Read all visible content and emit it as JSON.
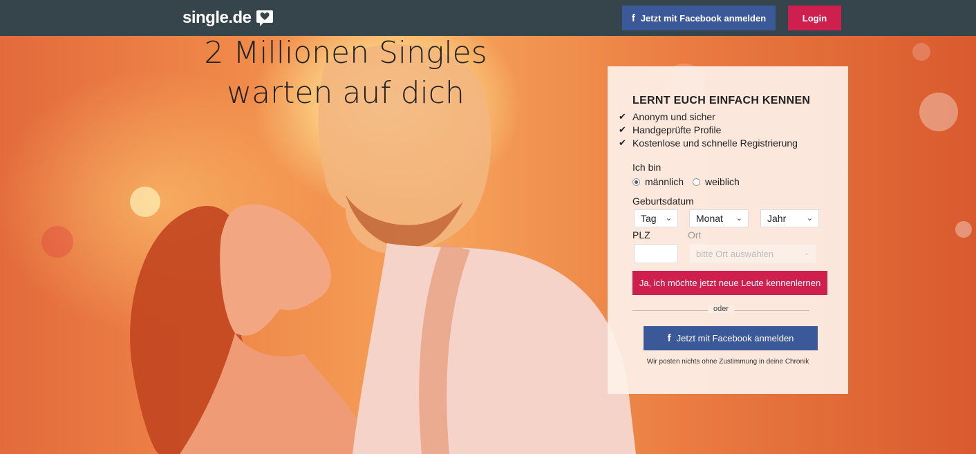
{
  "header": {
    "logo_text": "single.de",
    "facebook_button": "Jetzt mit Facebook anmelden",
    "login_button": "Login"
  },
  "hero": {
    "headline_line1": "2 Millionen Singles",
    "headline_line2": "warten auf dich"
  },
  "form": {
    "title": "LERNT EUCH EINFACH KENNEN",
    "benefits": [
      "Anonym und sicher",
      "Handgeprüfte Profile",
      "Kostenlose und schnelle Registrierung"
    ],
    "gender_label": "Ich bin",
    "gender_options": [
      "männlich",
      "weiblich"
    ],
    "gender_selected": "männlich",
    "birthdate_label": "Geburtsdatum",
    "day_select": "Tag",
    "month_select": "Monat",
    "year_select": "Jahr",
    "plz_label": "PLZ",
    "plz_value": "",
    "ort_label": "Ort",
    "ort_select": "bitte Ort auswählen",
    "submit_button": "Ja, ich möchte jetzt neue Leute kennenlernen",
    "separator": "oder",
    "facebook_button": "Jetzt mit Facebook anmelden",
    "facebook_note": "Wir posten nichts ohne Zustimmung in deine Chronik"
  },
  "colors": {
    "topbar": "#36454c",
    "facebook": "#3b5998",
    "accent": "#cf1f4f"
  },
  "icons": {
    "logo": "heart-speech-bubble-icon",
    "facebook": "facebook-f-icon",
    "benefit": "checkmark-icon",
    "dropdown": "chevron-down-icon"
  }
}
